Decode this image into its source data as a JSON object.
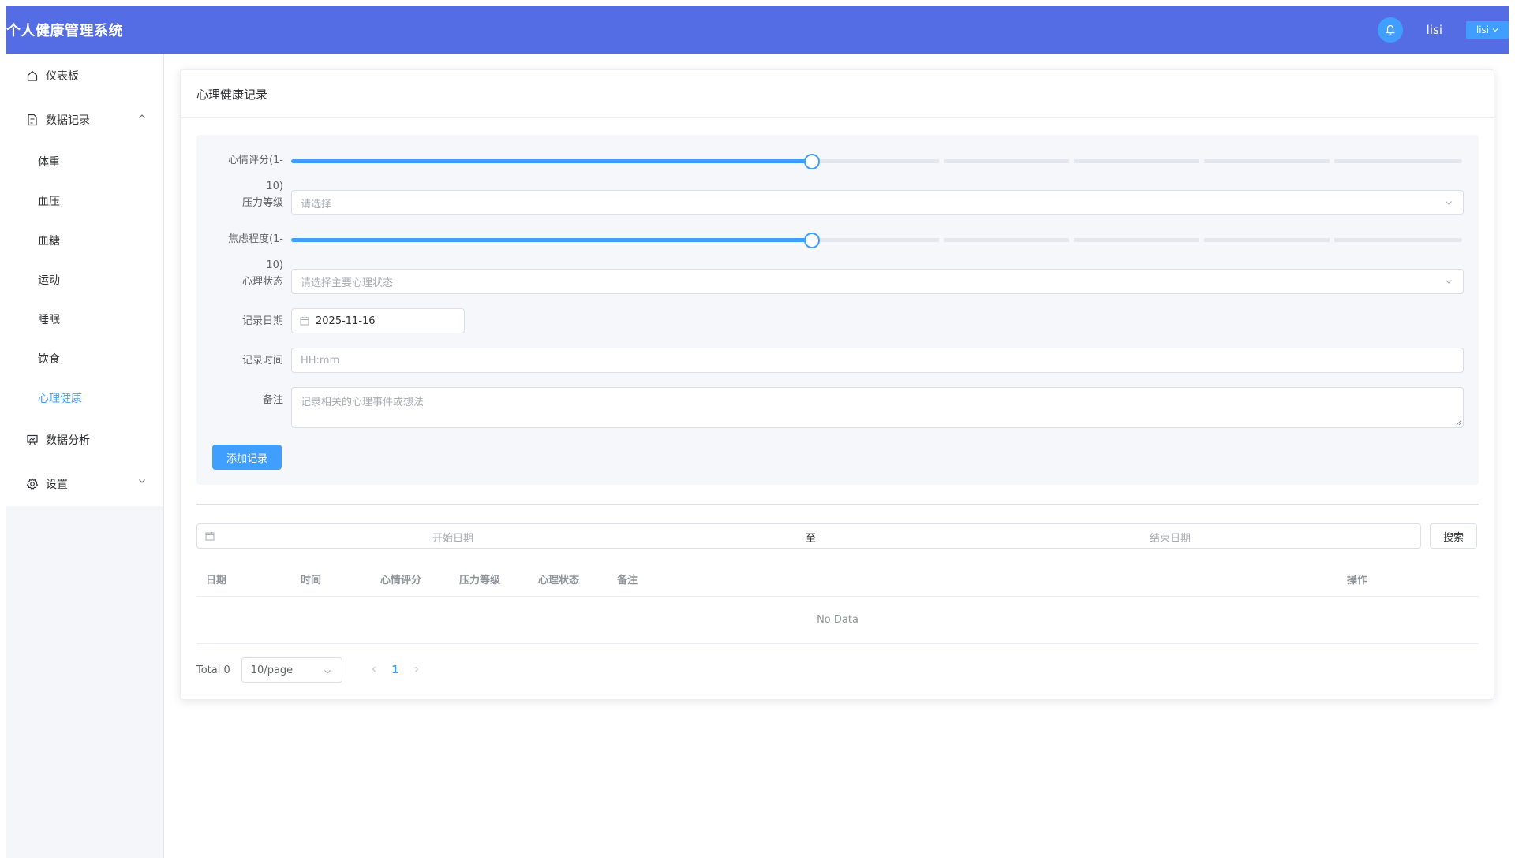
{
  "header": {
    "app_title": "个人健康管理系统",
    "username": "lisi",
    "user_button": "lisi"
  },
  "sidebar": {
    "items": [
      {
        "label": "仪表板",
        "icon": "home-icon"
      },
      {
        "label": "数据记录",
        "icon": "document-icon",
        "expanded": true
      },
      {
        "label": "数据分析",
        "icon": "chart-icon"
      },
      {
        "label": "设置",
        "icon": "gear-icon",
        "expanded": false
      }
    ],
    "sub_items": [
      "体重",
      "血压",
      "血糖",
      "运动",
      "睡眠",
      "饮食",
      "心理健康"
    ],
    "active_sub": "心理健康"
  },
  "card": {
    "title": "心理健康记录"
  },
  "form": {
    "mood_label_1": "心情评分(1-",
    "mood_label_2": "10)",
    "mood_value": 5,
    "stress_label": "压力等级",
    "stress_placeholder": "请选择",
    "anxiety_label_1": "焦虑程度(1-",
    "anxiety_label_2": "10)",
    "anxiety_value": 5,
    "mental_label": "心理状态",
    "mental_placeholder": "请选择主要心理状态",
    "date_label": "记录日期",
    "date_value": "2025-11-16",
    "time_label": "记录时间",
    "time_placeholder": "HH:mm",
    "notes_label": "备注",
    "notes_placeholder": "记录相关的心理事件或想法",
    "submit_label": "添加记录"
  },
  "filter": {
    "start_placeholder": "开始日期",
    "separator": "至",
    "end_placeholder": "结束日期",
    "search_label": "搜索"
  },
  "table": {
    "columns": [
      "日期",
      "时间",
      "心情评分",
      "压力等级",
      "心理状态",
      "备注",
      "操作"
    ],
    "empty_text": "No Data"
  },
  "pagination": {
    "total": "Total 0",
    "page_size": "10/page",
    "current_page": "1"
  },
  "colors": {
    "header_bg": "#546de5",
    "primary": "#409eff"
  }
}
